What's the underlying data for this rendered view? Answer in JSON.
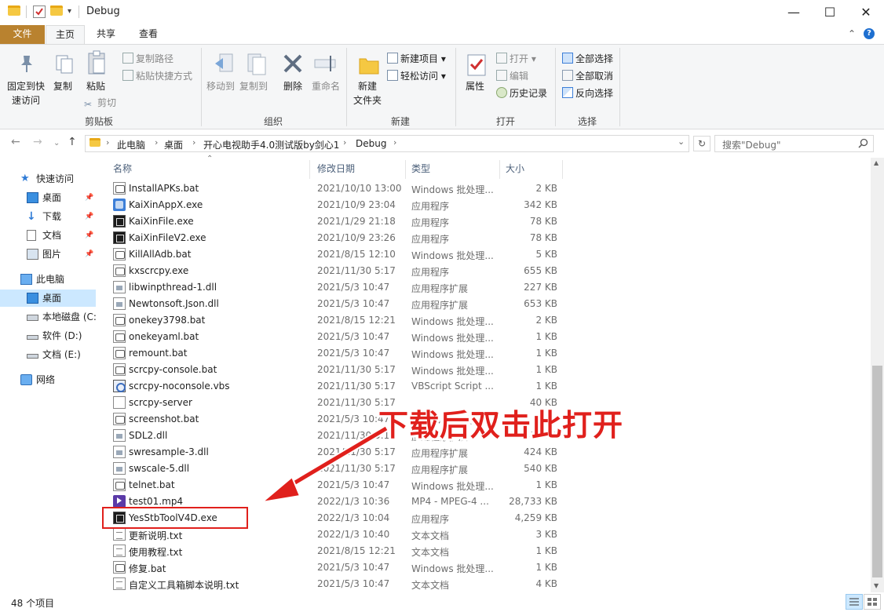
{
  "window": {
    "title": "Debug",
    "minimize": "—",
    "maximize": "☐",
    "close": "✕"
  },
  "ribbon_tabs": {
    "file": "文件",
    "home": "主页",
    "share": "共享",
    "view": "查看"
  },
  "ribbon": {
    "clipboard": {
      "pin": "固定到快",
      "pin2": "速访问",
      "copy": "复制",
      "paste": "粘贴",
      "copy_path": "复制路径",
      "paste_shortcut": "粘贴快捷方式",
      "cut": "剪切",
      "label": "剪贴板"
    },
    "organize": {
      "move_to": "移动到",
      "copy_to": "复制到",
      "delete": "删除",
      "rename": "重命名",
      "label": "组织"
    },
    "new": {
      "new_folder": "新建",
      "new_folder2": "文件夹",
      "new_item": "新建项目",
      "easy_access": "轻松访问",
      "label": "新建"
    },
    "open": {
      "properties": "属性",
      "open": "打开",
      "edit": "编辑",
      "history": "历史记录",
      "label": "打开"
    },
    "select": {
      "select_all": "全部选择",
      "select_none": "全部取消",
      "invert": "反向选择",
      "label": "选择"
    }
  },
  "address": {
    "crumbs": [
      "此电脑",
      "桌面",
      "开心电视助手4.0测试版by剑心1",
      "Debug"
    ],
    "search_placeholder": "搜索\"Debug\""
  },
  "nav": {
    "quick_access": "快速访问",
    "desktop": "桌面",
    "downloads": "下载",
    "documents": "文档",
    "pictures": "图片",
    "this_pc": "此电脑",
    "desktop2": "桌面",
    "local_c": "本地磁盘 (C:",
    "soft_d": "软件 (D:)",
    "doc_e": "文档 (E:)",
    "network": "网络"
  },
  "columns": {
    "name": "名称",
    "date": "修改日期",
    "type": "类型",
    "size": "大小"
  },
  "files": [
    {
      "name": "InstallAPKs.bat",
      "date": "2021/10/10 13:00",
      "type": "Windows 批处理...",
      "size": "2 KB",
      "icon": "bat"
    },
    {
      "name": "KaiXinAppX.exe",
      "date": "2021/10/9 23:04",
      "type": "应用程序",
      "size": "342 KB",
      "icon": "blue"
    },
    {
      "name": "KaiXinFile.exe",
      "date": "2021/1/29 21:18",
      "type": "应用程序",
      "size": "78 KB",
      "icon": "exe"
    },
    {
      "name": "KaiXinFileV2.exe",
      "date": "2021/10/9 23:26",
      "type": "应用程序",
      "size": "78 KB",
      "icon": "exe"
    },
    {
      "name": "KillAllAdb.bat",
      "date": "2021/8/15 12:10",
      "type": "Windows 批处理...",
      "size": "5 KB",
      "icon": "bat"
    },
    {
      "name": "kxscrcpy.exe",
      "date": "2021/11/30 5:17",
      "type": "应用程序",
      "size": "655 KB",
      "icon": "bat"
    },
    {
      "name": "libwinpthread-1.dll",
      "date": "2021/5/3 10:47",
      "type": "应用程序扩展",
      "size": "227 KB",
      "icon": "dll"
    },
    {
      "name": "Newtonsoft.Json.dll",
      "date": "2021/5/3 10:47",
      "type": "应用程序扩展",
      "size": "653 KB",
      "icon": "dll"
    },
    {
      "name": "onekey3798.bat",
      "date": "2021/8/15 12:21",
      "type": "Windows 批处理...",
      "size": "2 KB",
      "icon": "bat"
    },
    {
      "name": "onekeyaml.bat",
      "date": "2021/5/3 10:47",
      "type": "Windows 批处理...",
      "size": "1 KB",
      "icon": "bat"
    },
    {
      "name": "remount.bat",
      "date": "2021/5/3 10:47",
      "type": "Windows 批处理...",
      "size": "1 KB",
      "icon": "bat"
    },
    {
      "name": "scrcpy-console.bat",
      "date": "2021/11/30 5:17",
      "type": "Windows 批处理...",
      "size": "1 KB",
      "icon": "bat"
    },
    {
      "name": "scrcpy-noconsole.vbs",
      "date": "2021/11/30 5:17",
      "type": "VBScript Script ...",
      "size": "1 KB",
      "icon": "vbs"
    },
    {
      "name": "scrcpy-server",
      "date": "2021/11/30 5:17",
      "type": "",
      "size": "40 KB",
      "icon": "blank"
    },
    {
      "name": "screenshot.bat",
      "date": "2021/5/3 10:47",
      "type": "Windows 批处理...",
      "size": "1 KB",
      "icon": "bat"
    },
    {
      "name": "SDL2.dll",
      "date": "2021/11/30 5:17",
      "type": "应用程序扩展",
      "size": "1,491 KB",
      "icon": "dll"
    },
    {
      "name": "swresample-3.dll",
      "date": "2021/11/30 5:17",
      "type": "应用程序扩展",
      "size": "424 KB",
      "icon": "dll"
    },
    {
      "name": "swscale-5.dll",
      "date": "2021/11/30 5:17",
      "type": "应用程序扩展",
      "size": "540 KB",
      "icon": "dll"
    },
    {
      "name": "telnet.bat",
      "date": "2021/5/3 10:47",
      "type": "Windows 批处理...",
      "size": "1 KB",
      "icon": "bat"
    },
    {
      "name": "test01.mp4",
      "date": "2022/1/3 10:36",
      "type": "MP4 - MPEG-4 ...",
      "size": "28,733 KB",
      "icon": "mp4"
    },
    {
      "name": "YesStbToolV4D.exe",
      "date": "2022/1/3 10:04",
      "type": "应用程序",
      "size": "4,259 KB",
      "icon": "exe"
    },
    {
      "name": "更新说明.txt",
      "date": "2022/1/3 10:40",
      "type": "文本文档",
      "size": "3 KB",
      "icon": "txt"
    },
    {
      "name": "使用教程.txt",
      "date": "2021/8/15 12:21",
      "type": "文本文档",
      "size": "1 KB",
      "icon": "txt"
    },
    {
      "name": "修复.bat",
      "date": "2021/5/3 10:47",
      "type": "Windows 批处理...",
      "size": "1 KB",
      "icon": "bat"
    },
    {
      "name": "自定义工具箱脚本说明.txt",
      "date": "2021/5/3 10:47",
      "type": "文本文档",
      "size": "4 KB",
      "icon": "txt"
    }
  ],
  "status": {
    "count": "48 个项目"
  },
  "annotation": {
    "text": "下载后双击此打开"
  }
}
